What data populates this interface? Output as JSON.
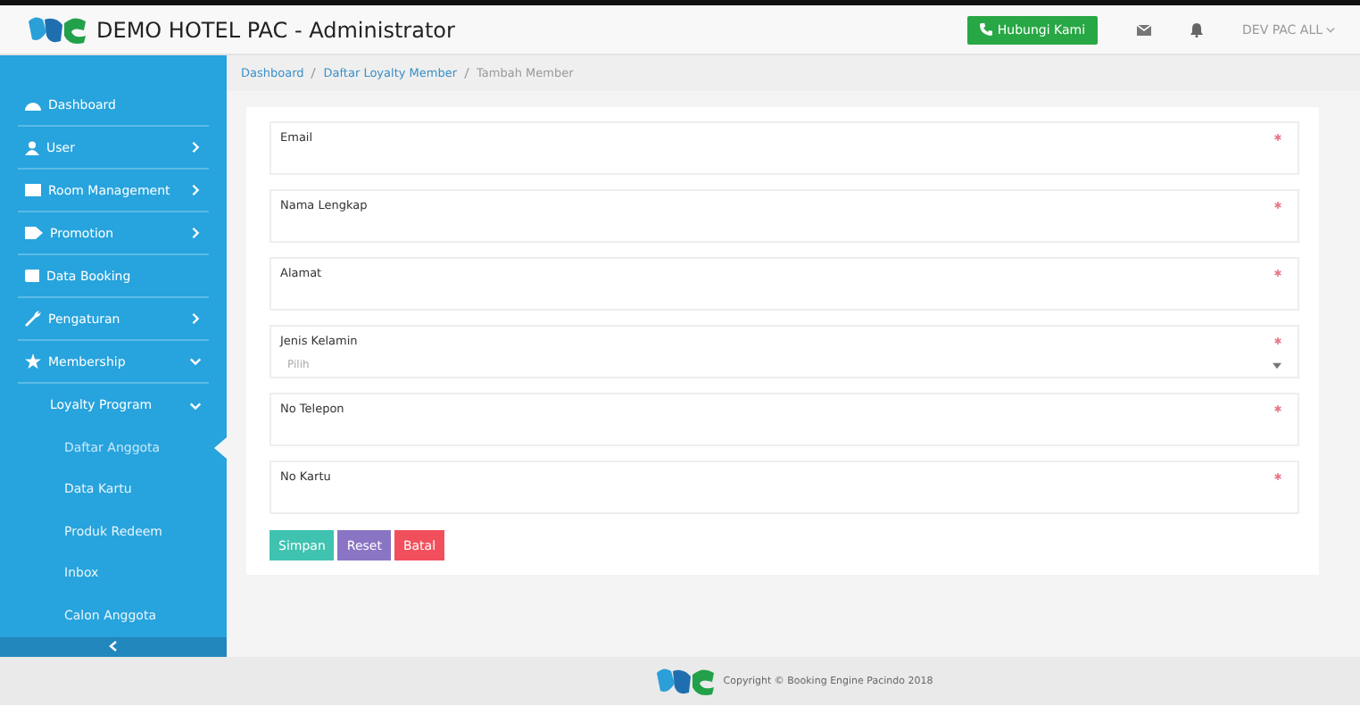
{
  "header": {
    "title": "DEMO HOTEL PAC - Administrator",
    "contact_button": "Hubungi Kami",
    "user_menu": "DEV PAC ALL"
  },
  "sidebar": {
    "items": [
      {
        "label": "Dashboard",
        "kind": "link",
        "selected": false
      },
      {
        "label": "User",
        "kind": "group",
        "expanded": false,
        "selected": false
      },
      {
        "label": "Room Management",
        "kind": "group",
        "expanded": false,
        "selected": false
      },
      {
        "label": "Promotion",
        "kind": "group",
        "expanded": false,
        "selected": false
      },
      {
        "label": "Data Booking",
        "kind": "link",
        "selected": false
      },
      {
        "label": "Pengaturan",
        "kind": "group",
        "expanded": false,
        "selected": false
      },
      {
        "label": "Membership",
        "kind": "group",
        "expanded": true,
        "selected": false,
        "children": [
          {
            "label": "Loyalty Program",
            "kind": "group",
            "expanded": true,
            "selected": false,
            "children": [
              {
                "label": "Daftar Anggota",
                "selected": true
              },
              {
                "label": "Data Kartu",
                "selected": false
              },
              {
                "label": "Produk Redeem",
                "selected": false
              },
              {
                "label": "Inbox",
                "selected": false
              },
              {
                "label": "Calon Anggota",
                "selected": false
              }
            ]
          }
        ]
      }
    ]
  },
  "breadcrumb": [
    {
      "label": "Dashboard",
      "link": true
    },
    {
      "label": "Daftar Loyalty Member",
      "link": true
    },
    {
      "label": "Tambah Member",
      "link": false
    }
  ],
  "form": {
    "fields": [
      {
        "kind": "text",
        "label": "Email",
        "required": true
      },
      {
        "kind": "text",
        "label": "Nama Lengkap",
        "required": true
      },
      {
        "kind": "text",
        "label": "Alamat",
        "required": true
      },
      {
        "kind": "select",
        "label": "Jenis Kelamin",
        "required": true,
        "placeholder": "Pilih"
      },
      {
        "kind": "text",
        "label": "No Telepon",
        "required": true
      },
      {
        "kind": "text",
        "label": "No Kartu",
        "required": true
      }
    ],
    "buttons": [
      {
        "label": "Simpan",
        "kind": "primary"
      },
      {
        "label": "Reset",
        "kind": "secondary"
      },
      {
        "label": "Batal",
        "kind": "danger"
      }
    ]
  },
  "footer": {
    "copyright": "Copyright © Booking Engine Pacindo 2018"
  }
}
